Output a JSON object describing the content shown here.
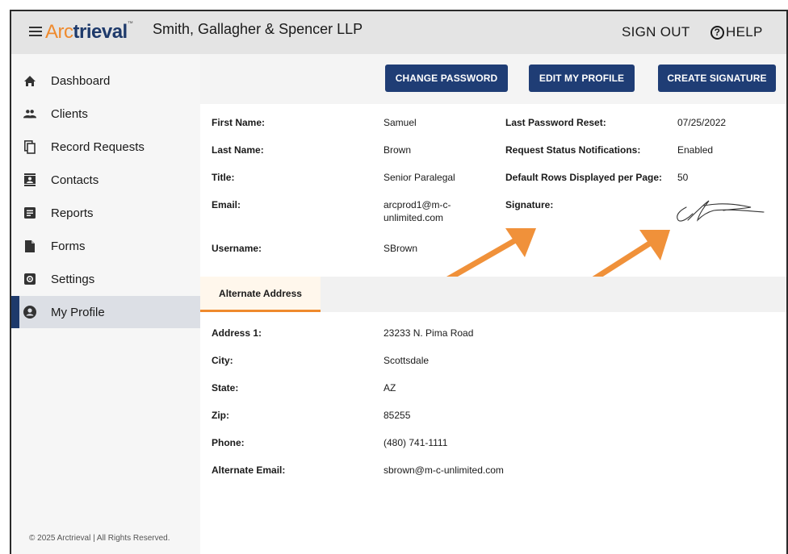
{
  "header": {
    "logo_arc": "Arc",
    "logo_trieval": "trieval",
    "logo_tm": "™",
    "firm_name": "Smith, Gallagher & Spencer LLP",
    "sign_out": "SIGN OUT",
    "help": "HELP",
    "help_glyph": "?"
  },
  "sidebar": {
    "items": [
      {
        "label": "Dashboard",
        "icon": "home-icon"
      },
      {
        "label": "Clients",
        "icon": "people-icon"
      },
      {
        "label": "Record Requests",
        "icon": "copy-icon"
      },
      {
        "label": "Contacts",
        "icon": "contact-card-icon"
      },
      {
        "label": "Reports",
        "icon": "report-icon"
      },
      {
        "label": "Forms",
        "icon": "file-icon"
      },
      {
        "label": "Settings",
        "icon": "gear-icon"
      },
      {
        "label": "My Profile",
        "icon": "account-icon",
        "active": true
      }
    ],
    "copyright": "© 2025 Arctrieval | All Rights Reserved."
  },
  "toolbar": {
    "change_password": "CHANGE PASSWORD",
    "edit_profile": "EDIT MY PROFILE",
    "create_signature": "CREATE SIGNATURE"
  },
  "profile": {
    "first_name_label": "First Name:",
    "first_name": "Samuel",
    "last_name_label": "Last Name:",
    "last_name": "Brown",
    "title_label": "Title:",
    "title": "Senior Paralegal",
    "email_label": "Email:",
    "email_line1": "arcprod1@m-c-",
    "email_line2": "unlimited.com",
    "username_label": "Username:",
    "username": "SBrown",
    "last_reset_label": "Last Password Reset:",
    "last_reset": "07/25/2022",
    "notifications_label": "Request Status Notifications:",
    "notifications": "Enabled",
    "rows_label": "Default Rows Displayed per Page:",
    "rows": "50",
    "signature_label": "Signature:"
  },
  "alternate": {
    "tab_label": "Alternate Address",
    "address1_label": "Address 1:",
    "address1": "23233 N. Pima Road",
    "city_label": "City:",
    "city": "Scottsdale",
    "state_label": "State:",
    "state": "AZ",
    "zip_label": "Zip:",
    "zip": "85255",
    "phone_label": "Phone:",
    "phone": "(480) 741-1111",
    "alt_email_label": "Alternate Email:",
    "alt_email": "sbrown@m-c-unlimited.com"
  },
  "colors": {
    "brand_navy": "#1f3d75",
    "accent_orange": "#ef8a2d",
    "annotation_arrow": "#f0913a"
  }
}
